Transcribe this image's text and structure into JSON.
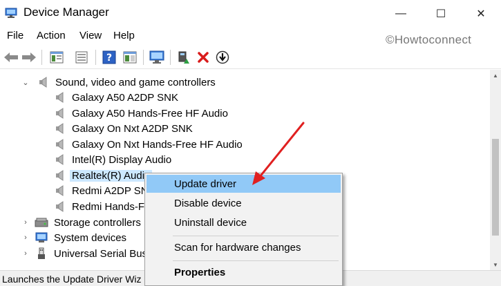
{
  "window": {
    "title": "Device Manager",
    "minimize_glyph": "—",
    "maximize_glyph": "☐",
    "close_glyph": "✕"
  },
  "menu": [
    "File",
    "Action",
    "View",
    "Help"
  ],
  "watermark": "©Howtoconnect",
  "toolbar": {
    "icons": [
      "back-arrow-icon",
      "forward-arrow-icon",
      "properties-console-icon",
      "console-tree-icon",
      "help-icon",
      "action-pane-icon",
      "monitor-scan-icon",
      "update-driver-icon",
      "uninstall-x-icon",
      "disable-device-icon"
    ]
  },
  "tree": {
    "category": "Sound, video and game controllers",
    "children": [
      "Galaxy A50 A2DP SNK",
      "Galaxy A50 Hands-Free HF Audio",
      "Galaxy On Nxt A2DP SNK",
      "Galaxy On Nxt Hands-Free HF Audio",
      "Intel(R) Display Audio",
      "Realtek(R) Audio",
      "Redmi A2DP SNK",
      "Redmi Hands-Free"
    ],
    "selected": "Realtek(R) Audio",
    "siblings": [
      "Storage controllers",
      "System devices",
      "Universal Serial Bus"
    ]
  },
  "context_menu": {
    "items": [
      "Update driver",
      "Disable device",
      "Uninstall device",
      "Scan for hardware changes",
      "Properties"
    ],
    "highlighted": "Update driver"
  },
  "status": "Launches the Update Driver Wiz",
  "colors": {
    "selection": "#cce8ff",
    "menu_highlight": "#91c9f7",
    "annotation_arrow": "#e02020"
  }
}
